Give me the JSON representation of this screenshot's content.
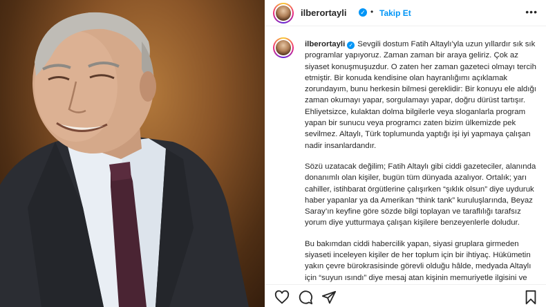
{
  "post": {
    "username": "ilberortayli",
    "follow_label": "Takip Et",
    "separator": "•",
    "more_label": "•••",
    "caption_paragraphs": [
      "Sevgili dostum Fatih Altaylı’yla uzun yıllardır sık sık programlar yapıyoruz. Zaman zaman bir araya geliriz. Çok az siyaset konuşmuşuzdur. O zaten her zaman gazeteci olmayı tercih etmiştir. Bir konuda kendisine olan hayranlığımı açıklamak zorundayım, bunu herkesin bilmesi gereklidir: Bir konuyu ele aldığı zaman okumayı yapar, sorgulamayı yapar, doğru dürüst tartışır. Ehliyetsizce, kulaktan dolma bilgilerle veya sloganlarla program yapan bir sunucu veya programcı zaten bizim ülkemizde pek sevilmez. Altaylı, Türk toplumunda yaptığı işi iyi yapmaya çalışan nadir insanlardandır.",
      "Sözü uzatacak değilim; Fatih Altaylı gibi ciddi gazeteciler, alanında donanımlı olan kişiler, bugün tüm dünyada azalıyor. Ortalık; yarı cahiller, istihbarat örgütlerine çalışırken “şıklık olsun” diye uyduruk haber yapanlar ya da Amerikan “think tank” kuruluşlarında, Beyaz Saray’ın keyfine göre sözde bilgi toplayan ve taraflılığı tarafsız yorum diye yutturmaya çalışan kişilere benzeyenlerle doludur.",
      "Bu bakımdan ciddi habercilik yapan, siyasi gruplara girmeden siyaseti inceleyen kişiler de her toplum için bir ihtiyaç. Hükümetin yakın çevre bürokrasisinde görevli olduğu hâlde, medyada Altaylı için “suyun ısındı” diye mesaj atan kişinin memuriyetle ilgisini ve"
    ]
  },
  "actions": {
    "like_icon": "heart-icon",
    "comment_icon": "comment-icon",
    "share_icon": "send-icon",
    "save_icon": "bookmark-icon"
  },
  "colors": {
    "accent": "#0095f6",
    "text": "#262626",
    "divider": "#efefef",
    "photo_bg": "#8a5528"
  }
}
